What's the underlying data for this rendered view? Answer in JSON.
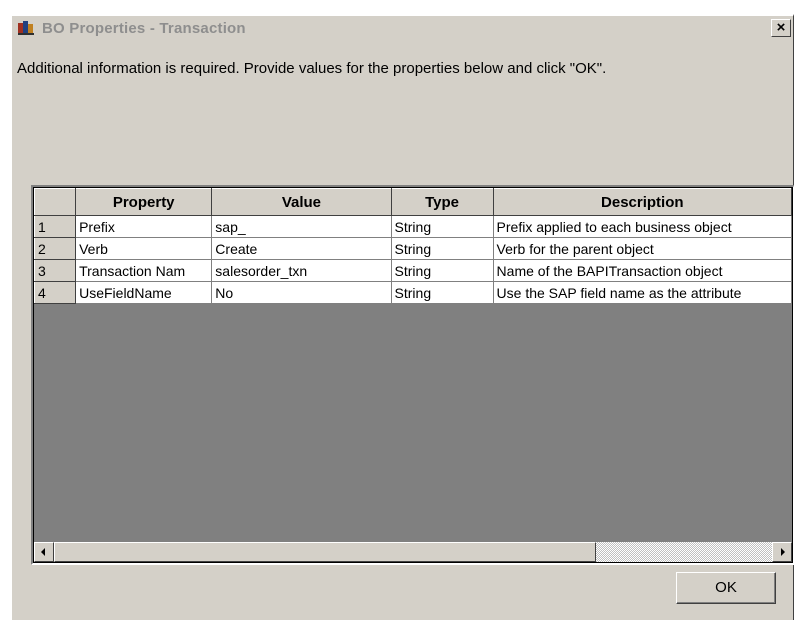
{
  "window": {
    "title": "BO Properties - Transaction",
    "close_label": "×"
  },
  "instructions": "Additional information is required. Provide values for the properties below and click \"OK\".",
  "grid": {
    "columns": [
      "Property",
      "Value",
      "Type",
      "Description"
    ],
    "rows": [
      {
        "num": "1",
        "property": "Prefix",
        "value": "sap_",
        "type": "String",
        "description": "Prefix applied to each business object"
      },
      {
        "num": "2",
        "property": "Verb",
        "value": "Create",
        "type": "String",
        "description": "Verb for the parent object"
      },
      {
        "num": "3",
        "property": "Transaction Nam",
        "value": "salesorder_txn",
        "type": "String",
        "description": "Name of the BAPITransaction object"
      },
      {
        "num": "4",
        "property": "UseFieldName",
        "value": "No",
        "type": "String",
        "description": "Use the SAP field name as the attribute"
      }
    ]
  },
  "buttons": {
    "ok_label": "OK"
  },
  "colors": {
    "dialog_bg": "#d4d0c8",
    "grid_bg": "#808080",
    "title_text": "#8e8e8e"
  }
}
